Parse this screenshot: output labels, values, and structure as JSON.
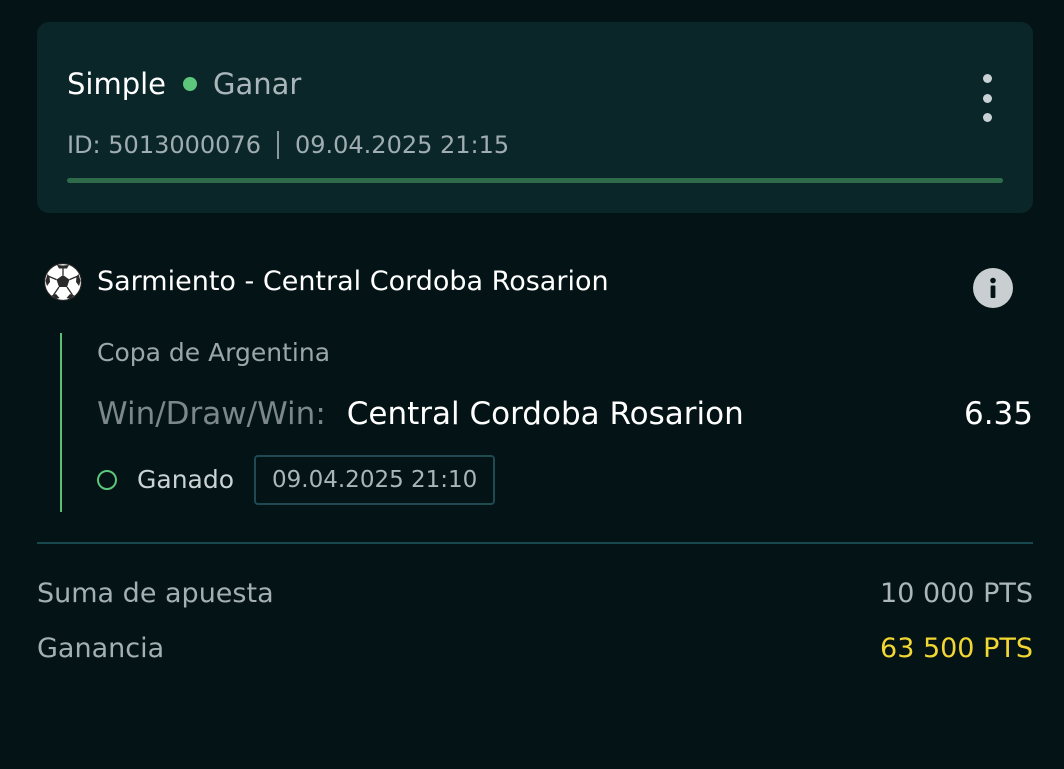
{
  "bet": {
    "type": "Simple",
    "status": "Ganar",
    "status_color": "#5cc77a",
    "id_text": "ID: 5013000076",
    "datetime": "09.04.2025 21:15",
    "progress": 1.0
  },
  "event": {
    "sport_icon": "soccer-ball-icon",
    "name": "Sarmiento - Central Cordoba Rosarion",
    "tournament": "Copa de Argentina",
    "market_label": "Win/Draw/Win:",
    "selection": "Central Cordoba Rosarion",
    "odds": "6.35",
    "result_label": "Ganado",
    "result_datetime": "09.04.2025 21:10"
  },
  "summary": {
    "stake_label": "Suma de apuesta",
    "stake_value": "10 000 PTS",
    "win_label": "Ganancia",
    "win_value": "63 500 PTS",
    "win_color": "#f2d633"
  }
}
